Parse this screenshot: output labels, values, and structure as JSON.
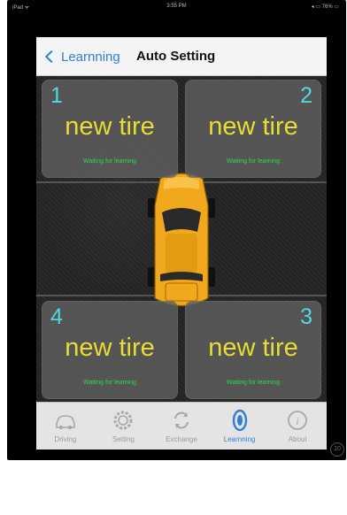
{
  "status_bar": {
    "carrier": "iPad ᯤ",
    "time": "3:55 PM",
    "battery": "◂ ▭ 76% ▭"
  },
  "nav": {
    "back_label": "Learnning",
    "title": "Auto Setting"
  },
  "tires": [
    {
      "number": "1",
      "label": "new tire",
      "status": "Waiting for learning"
    },
    {
      "number": "2",
      "label": "new tire",
      "status": "Waiting for learning"
    },
    {
      "number": "4",
      "label": "new tire",
      "status": "Waiting for learning"
    },
    {
      "number": "3",
      "label": "new tire",
      "status": "Waiting for learning"
    }
  ],
  "tabs": [
    {
      "label": "Driving",
      "icon": "car-icon"
    },
    {
      "label": "Setting",
      "icon": "gear-icon"
    },
    {
      "label": "Exchange",
      "icon": "exchange-icon"
    },
    {
      "label": "Learnning",
      "icon": "tire-icon",
      "active": true
    },
    {
      "label": "About",
      "icon": "info-icon"
    }
  ],
  "badge": "10",
  "colors": {
    "accent": "#2f7fd6",
    "tire_number": "#53d6e0",
    "tire_label": "#e8dd33",
    "status_text": "#34d64a",
    "car_body": "#f2a81c"
  }
}
